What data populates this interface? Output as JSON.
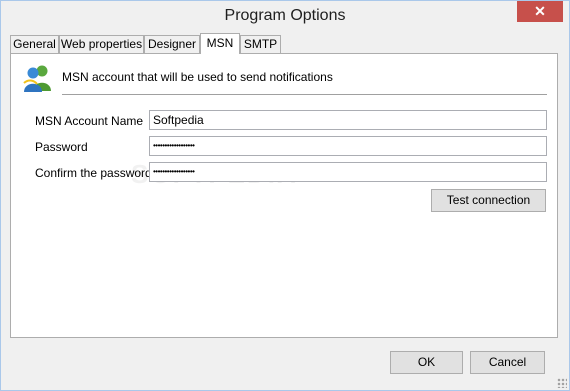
{
  "window": {
    "title": "Program Options",
    "close_glyph": "✕"
  },
  "tabs": [
    {
      "label": "General"
    },
    {
      "label": "Web properties"
    },
    {
      "label": "Designer"
    },
    {
      "label": "MSN"
    },
    {
      "label": "SMTP"
    }
  ],
  "active_tab": "MSN",
  "msn": {
    "icon": "msn-messenger-icon",
    "description": "MSN account that will be used to send notifications",
    "account_label": "MSN Account Name",
    "account_value": "Softpedia",
    "password_label": "Password",
    "password_value": "••••••••••••••••••",
    "confirm_label": "Confirm the password",
    "confirm_value": "••••••••••••••••••",
    "test_button": "Test connection"
  },
  "watermark": "SOFTPEDIA",
  "footer": {
    "ok_label": "OK",
    "cancel_label": "Cancel"
  },
  "colors": {
    "close_button": "#c7504b",
    "window_border": "#aac8ea"
  }
}
